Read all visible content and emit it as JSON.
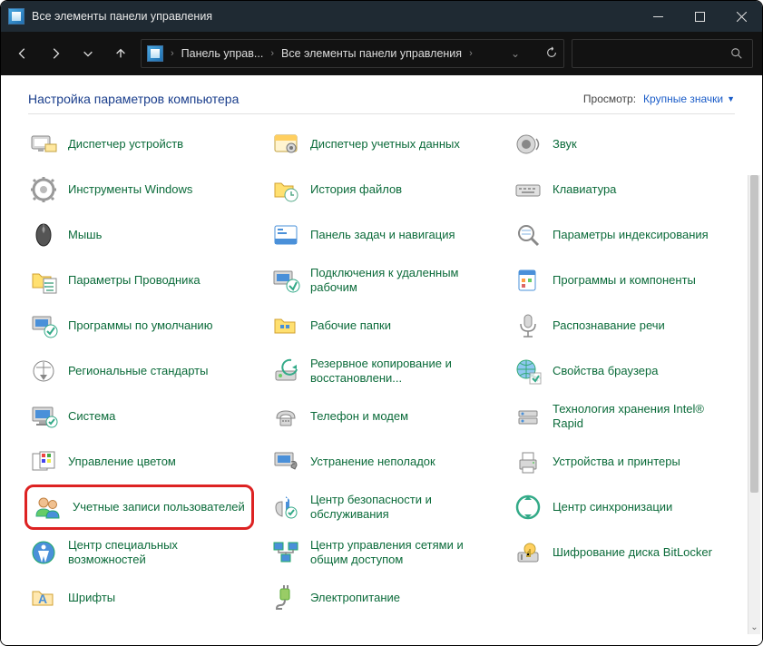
{
  "window": {
    "title": "Все элементы панели управления"
  },
  "breadcrumb": {
    "seg1": "Панель управ...",
    "seg2": "Все элементы панели управления"
  },
  "header": {
    "title": "Настройка параметров компьютера",
    "view_label": "Просмотр:",
    "view_value": "Крупные значки"
  },
  "items": [
    [
      {
        "label": "Диспетчер устройств",
        "icon": "device-manager-icon"
      },
      {
        "label": "Диспетчер учетных данных",
        "icon": "credentials-icon"
      },
      {
        "label": "Звук",
        "icon": "sound-icon"
      }
    ],
    [
      {
        "label": "Инструменты Windows",
        "icon": "tools-icon"
      },
      {
        "label": "История файлов",
        "icon": "file-history-icon"
      },
      {
        "label": "Клавиатура",
        "icon": "keyboard-icon"
      }
    ],
    [
      {
        "label": "Мышь",
        "icon": "mouse-icon"
      },
      {
        "label": "Панель задач и навигация",
        "icon": "taskbar-icon"
      },
      {
        "label": "Параметры индексирования",
        "icon": "indexing-icon"
      }
    ],
    [
      {
        "label": "Параметры Проводника",
        "icon": "explorer-options-icon"
      },
      {
        "label": "Подключения к удаленным рабочим",
        "icon": "remote-desktop-icon"
      },
      {
        "label": "Программы и компоненты",
        "icon": "programs-icon"
      }
    ],
    [
      {
        "label": "Программы по умолчанию",
        "icon": "default-programs-icon"
      },
      {
        "label": "Рабочие папки",
        "icon": "work-folders-icon"
      },
      {
        "label": "Распознавание речи",
        "icon": "speech-icon"
      }
    ],
    [
      {
        "label": "Региональные стандарты",
        "icon": "region-icon"
      },
      {
        "label": "Резервное копирование и восстановлени...",
        "icon": "backup-icon"
      },
      {
        "label": "Свойства браузера",
        "icon": "internet-options-icon"
      }
    ],
    [
      {
        "label": "Система",
        "icon": "system-icon"
      },
      {
        "label": "Телефон и модем",
        "icon": "phone-modem-icon"
      },
      {
        "label": "Технология хранения Intel® Rapid",
        "icon": "intel-rapid-icon"
      }
    ],
    [
      {
        "label": "Управление цветом",
        "icon": "color-mgmt-icon"
      },
      {
        "label": "Устранение неполадок",
        "icon": "troubleshoot-icon"
      },
      {
        "label": "Устройства и принтеры",
        "icon": "devices-printers-icon"
      }
    ],
    [
      {
        "label": "Учетные записи пользователей",
        "icon": "user-accounts-icon",
        "highlight": true
      },
      {
        "label": "Центр безопасности и обслуживания",
        "icon": "security-center-icon"
      },
      {
        "label": "Центр синхронизации",
        "icon": "sync-center-icon"
      }
    ],
    [
      {
        "label": "Центр специальных возможностей",
        "icon": "ease-access-icon"
      },
      {
        "label": "Центр управления сетями и общим доступом",
        "icon": "network-center-icon"
      },
      {
        "label": "Шифрование диска BitLocker",
        "icon": "bitlocker-icon"
      }
    ],
    [
      {
        "label": "Шрифты",
        "icon": "fonts-icon"
      },
      {
        "label": "Электропитание",
        "icon": "power-icon"
      },
      {
        "label": "",
        "icon": "empty"
      }
    ]
  ]
}
